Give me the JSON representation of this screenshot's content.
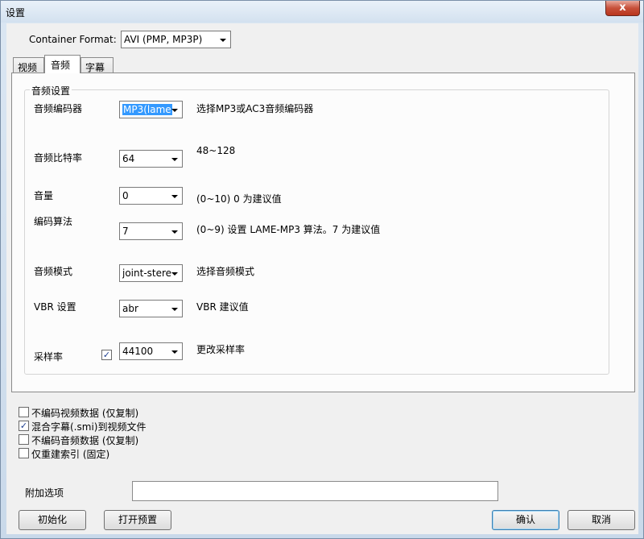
{
  "window": {
    "title": "设置",
    "close_glyph": "x"
  },
  "container": {
    "label": "Container Format:",
    "value": "AVI (PMP, MP3P)"
  },
  "tabs": [
    {
      "label": "视频"
    },
    {
      "label": "音频"
    },
    {
      "label": "字幕"
    }
  ],
  "audio_group": {
    "title": "音频设置",
    "encoder": {
      "label": "音频编码器",
      "value": "MP3(lame",
      "hint": "选择MP3或AC3音频编码器"
    },
    "bitrate": {
      "label": "音频比特率",
      "value": "64",
      "hint": "48~128"
    },
    "volume": {
      "label": "音量",
      "value": "0",
      "hint": "(0~10) 0 为建议值"
    },
    "algorithm": {
      "label": "编码算法",
      "value": "7",
      "hint": "(0~9) 设置 LAME-MP3 算法。7 为建议值"
    },
    "mode": {
      "label": "音频模式",
      "value": "joint-stere",
      "hint": "选择音频模式"
    },
    "vbr": {
      "label": "VBR 设置",
      "value": "abr",
      "hint": "VBR 建议值"
    },
    "samplerate": {
      "label": "采样率",
      "checked": true,
      "check_glyph": "✓",
      "value": "44100",
      "hint": "更改采样率"
    }
  },
  "options": [
    {
      "label": "不编码视频数据 (仅复制)",
      "checked": false
    },
    {
      "label": "混合字幕(.smi)到视频文件",
      "checked": true
    },
    {
      "label": "不编码音频数据 (仅复制)",
      "checked": false
    },
    {
      "label": "仅重建索引 (固定)",
      "checked": false
    }
  ],
  "extra": {
    "label": "附加选项",
    "value": ""
  },
  "buttons": {
    "reset": "初始化",
    "open_preset": "打开预置",
    "ok": "确认",
    "cancel": "取消"
  }
}
